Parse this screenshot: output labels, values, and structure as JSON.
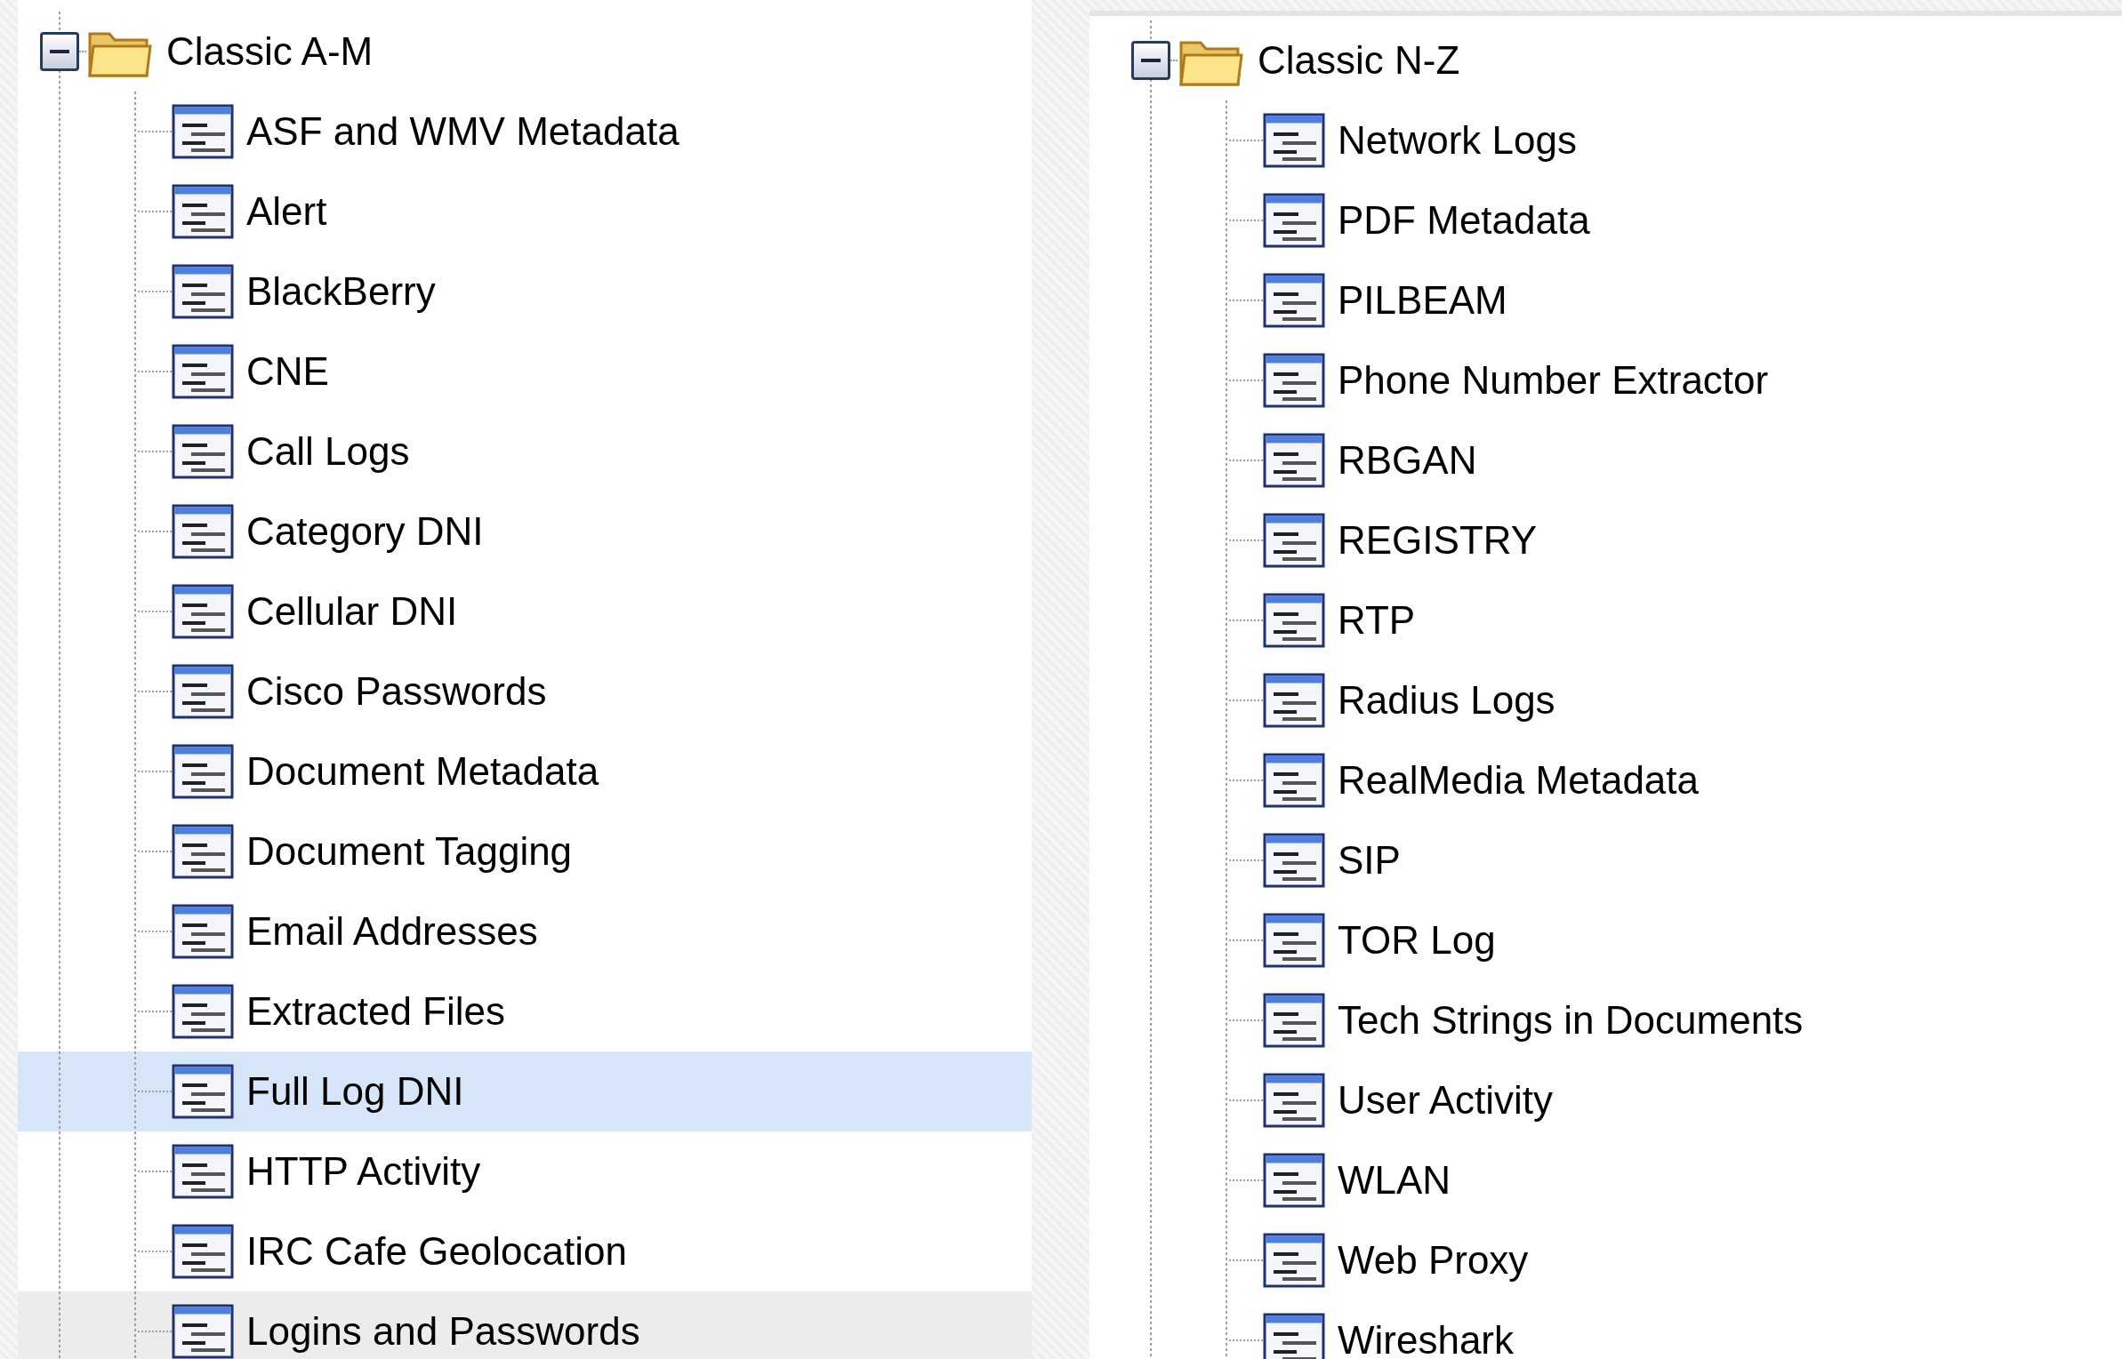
{
  "panels": [
    {
      "title": "Classic A-M",
      "expanded": true,
      "items": [
        {
          "label": "ASF and WMV Metadata",
          "selected": false,
          "hovered": false
        },
        {
          "label": "Alert",
          "selected": false,
          "hovered": false
        },
        {
          "label": "BlackBerry",
          "selected": false,
          "hovered": false
        },
        {
          "label": "CNE",
          "selected": false,
          "hovered": false
        },
        {
          "label": "Call Logs",
          "selected": false,
          "hovered": false
        },
        {
          "label": "Category DNI",
          "selected": false,
          "hovered": false
        },
        {
          "label": "Cellular DNI",
          "selected": false,
          "hovered": false
        },
        {
          "label": "Cisco Passwords",
          "selected": false,
          "hovered": false
        },
        {
          "label": "Document Metadata",
          "selected": false,
          "hovered": false
        },
        {
          "label": "Document Tagging",
          "selected": false,
          "hovered": false
        },
        {
          "label": "Email Addresses",
          "selected": false,
          "hovered": false
        },
        {
          "label": "Extracted Files",
          "selected": false,
          "hovered": false
        },
        {
          "label": "Full Log DNI",
          "selected": true,
          "hovered": false
        },
        {
          "label": "HTTP Activity",
          "selected": false,
          "hovered": false
        },
        {
          "label": "IRC Cafe Geolocation",
          "selected": false,
          "hovered": false
        },
        {
          "label": "Logins and Passwords",
          "selected": false,
          "hovered": true
        }
      ]
    },
    {
      "title": "Classic N-Z",
      "expanded": true,
      "items": [
        {
          "label": "Network Logs",
          "selected": false,
          "hovered": false
        },
        {
          "label": "PDF Metadata",
          "selected": false,
          "hovered": false
        },
        {
          "label": "PILBEAM",
          "selected": false,
          "hovered": false
        },
        {
          "label": "Phone Number Extractor",
          "selected": false,
          "hovered": false
        },
        {
          "label": "RBGAN",
          "selected": false,
          "hovered": false
        },
        {
          "label": "REGISTRY",
          "selected": false,
          "hovered": false
        },
        {
          "label": "RTP",
          "selected": false,
          "hovered": false
        },
        {
          "label": "Radius Logs",
          "selected": false,
          "hovered": false
        },
        {
          "label": "RealMedia Metadata",
          "selected": false,
          "hovered": false
        },
        {
          "label": "SIP",
          "selected": false,
          "hovered": false
        },
        {
          "label": "TOR Log",
          "selected": false,
          "hovered": false
        },
        {
          "label": "Tech Strings in Documents",
          "selected": false,
          "hovered": false
        },
        {
          "label": "User Activity",
          "selected": false,
          "hovered": false
        },
        {
          "label": "WLAN",
          "selected": false,
          "hovered": false
        },
        {
          "label": "Web Proxy",
          "selected": false,
          "hovered": false
        },
        {
          "label": "Wireshark",
          "selected": false,
          "hovered": false
        }
      ]
    }
  ]
}
